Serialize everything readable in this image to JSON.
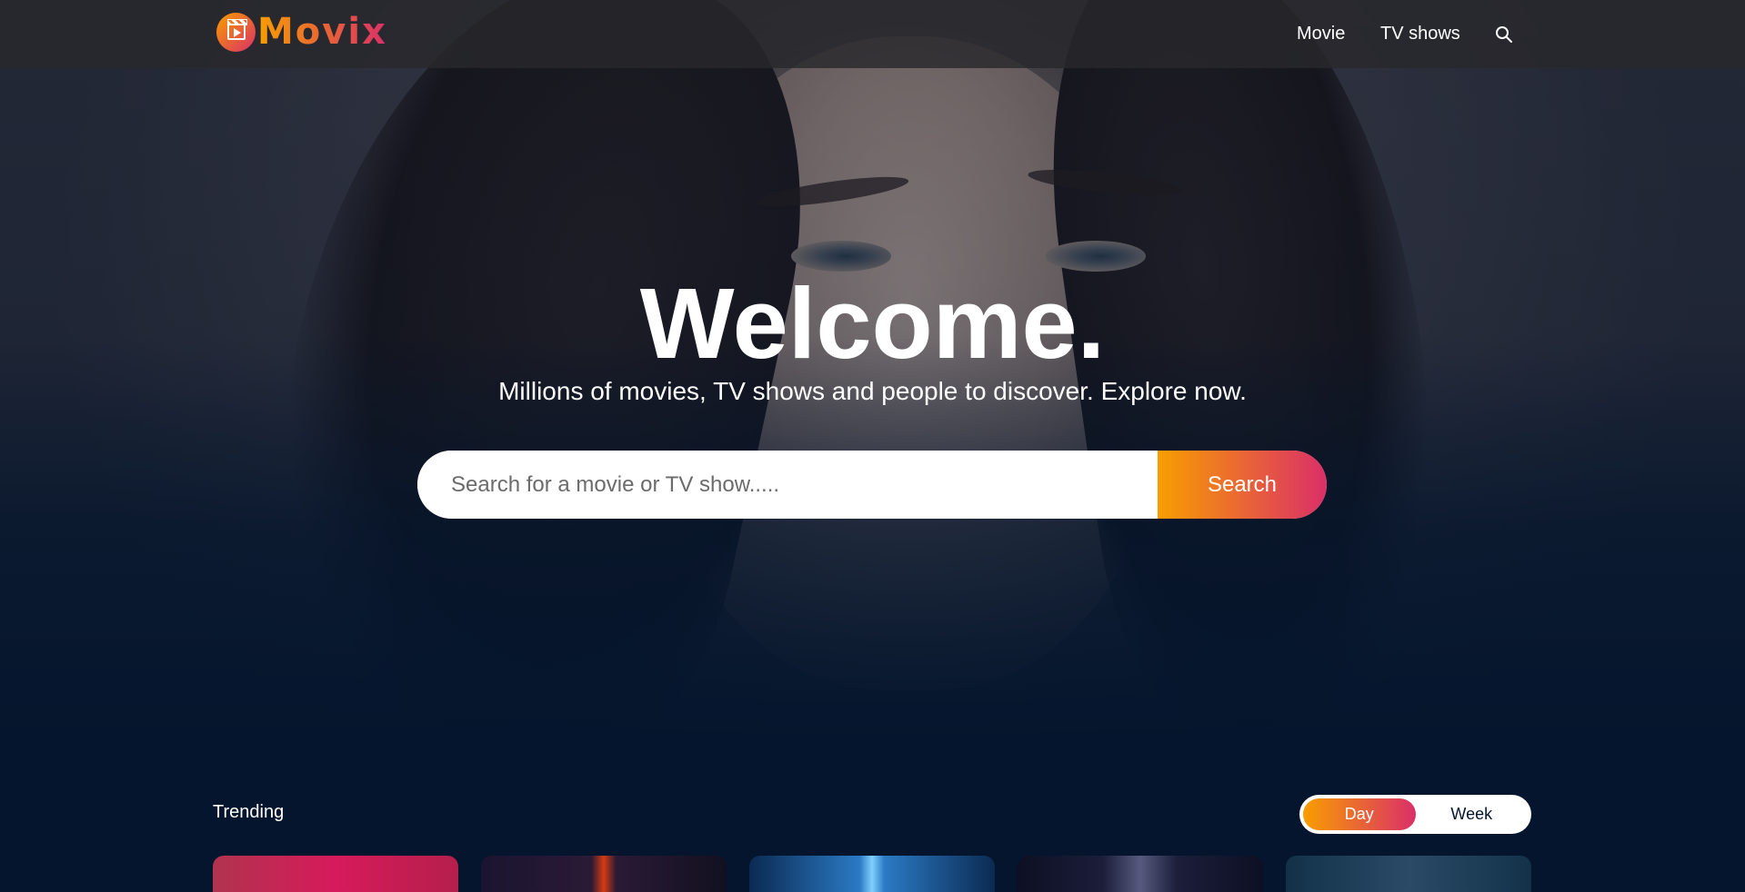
{
  "header": {
    "logo_text": "Movix",
    "nav": {
      "movie_label": "Movie",
      "tv_label": "TV shows",
      "search_icon": "search-icon"
    }
  },
  "hero": {
    "title": "Welcome.",
    "subtitle": "Millions of movies, TV shows and people to discover. Explore now.",
    "search": {
      "placeholder": "Search for a movie or TV show.....",
      "value": "",
      "button_label": "Search"
    }
  },
  "trending": {
    "title": "Trending",
    "tabs": [
      "Day",
      "Week"
    ],
    "active_tab": "Day"
  },
  "colors": {
    "background": "#04152d",
    "gradient_start": "#f89e00",
    "gradient_end": "#da2f68"
  }
}
